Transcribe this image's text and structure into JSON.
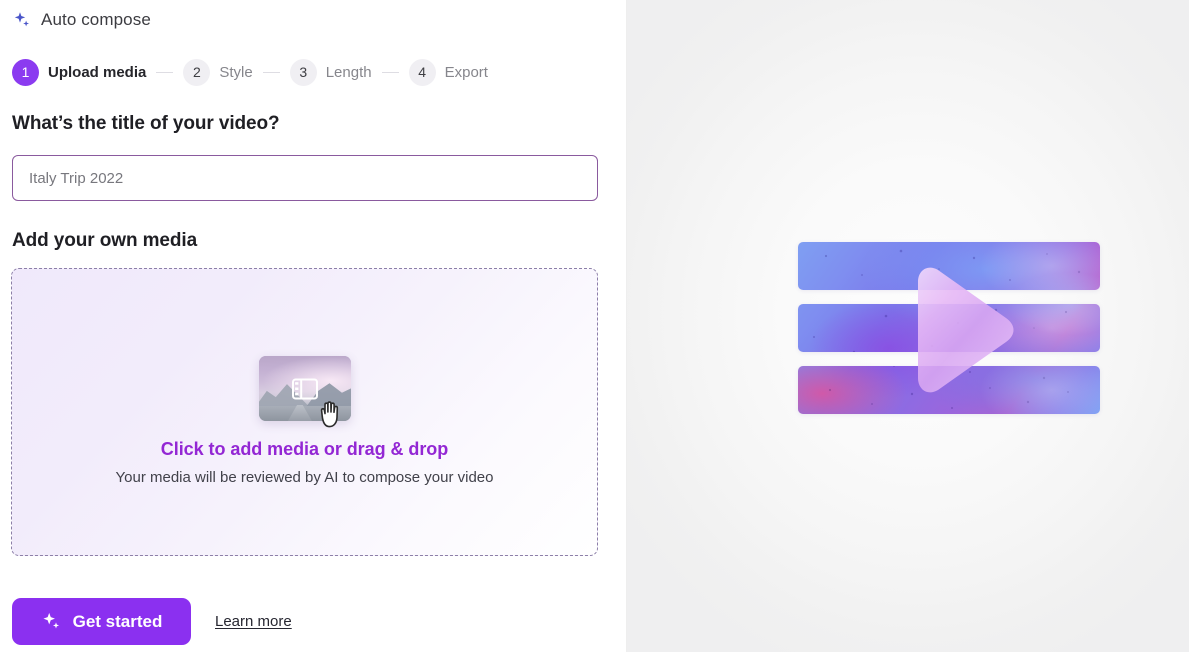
{
  "brand": {
    "title": "Auto compose",
    "icon": "sparkle-icon"
  },
  "stepper": {
    "steps": [
      {
        "number": "1",
        "label": "Upload media",
        "state": "active"
      },
      {
        "number": "2",
        "label": "Style",
        "state": "inactive"
      },
      {
        "number": "3",
        "label": "Length",
        "state": "inactive"
      },
      {
        "number": "4",
        "label": "Export",
        "state": "inactive"
      }
    ]
  },
  "form": {
    "title_heading": "What’s the title of your video?",
    "title_placeholder": "Italy Trip 2022",
    "title_value": "",
    "media_heading": "Add your own media"
  },
  "dropzone": {
    "primary_text": "Click to add media or drag & drop",
    "secondary_text": "Your media will be reviewed by AI to compose your video",
    "thumbnail_icon": "film-strip-icon",
    "cursor_icon": "grab-hand-cursor"
  },
  "footer": {
    "get_started_label": "Get started",
    "get_started_icon": "sparkle-icon",
    "learn_more_label": "Learn more"
  },
  "preview": {
    "play_icon": "play-triangle-icon",
    "band_count": "3"
  },
  "colors": {
    "accent_purple": "#8b30f0",
    "step_active": "#8b3bf0",
    "dropzone_link": "#9327d4",
    "input_border": "#8a5a9e",
    "brand_icon": "#4a55c9",
    "right_panel_bg": "#f2f2f2"
  }
}
